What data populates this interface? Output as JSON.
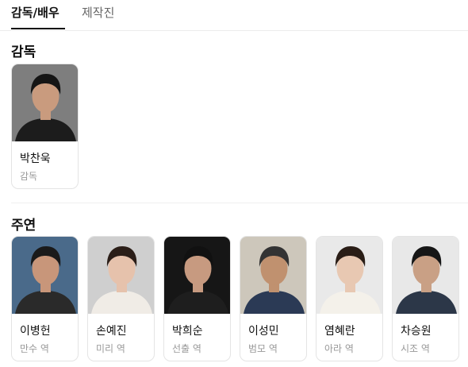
{
  "tabs": [
    {
      "label": "감독/배우",
      "active": true
    },
    {
      "label": "제작진",
      "active": false
    }
  ],
  "sections": {
    "director": {
      "title": "감독",
      "people": [
        {
          "name": "박찬욱",
          "role": "감독",
          "bg": "#7e7e7e",
          "hair": "#151515",
          "skin": "#c99b7e",
          "cloth": "#1c1c1c"
        }
      ]
    },
    "lead": {
      "title": "주연",
      "people": [
        {
          "name": "이병헌",
          "role": "만수 역",
          "bg": "#4a6a8a",
          "hair": "#1a1a1a",
          "skin": "#c8967a",
          "cloth": "#2a2a2a"
        },
        {
          "name": "손예진",
          "role": "미리 역",
          "bg": "#cfcfcf",
          "hair": "#2b1e18",
          "skin": "#e6c2ac",
          "cloth": "#f0ece6"
        },
        {
          "name": "박희순",
          "role": "선출 역",
          "bg": "#161616",
          "hair": "#111111",
          "skin": "#c79a80",
          "cloth": "#1e1e1e"
        },
        {
          "name": "이성민",
          "role": "범모 역",
          "bg": "#cdc7bb",
          "hair": "#333333",
          "skin": "#c0916f",
          "cloth": "#2b3a55"
        },
        {
          "name": "염혜란",
          "role": "아라 역",
          "bg": "#e9e9e9",
          "hair": "#2a1d16",
          "skin": "#e8c8b2",
          "cloth": "#f4f1ea"
        },
        {
          "name": "차승원",
          "role": "시조 역",
          "bg": "#e8e8e8",
          "hair": "#161616",
          "skin": "#c9a085",
          "cloth": "#2c3748"
        }
      ]
    }
  }
}
